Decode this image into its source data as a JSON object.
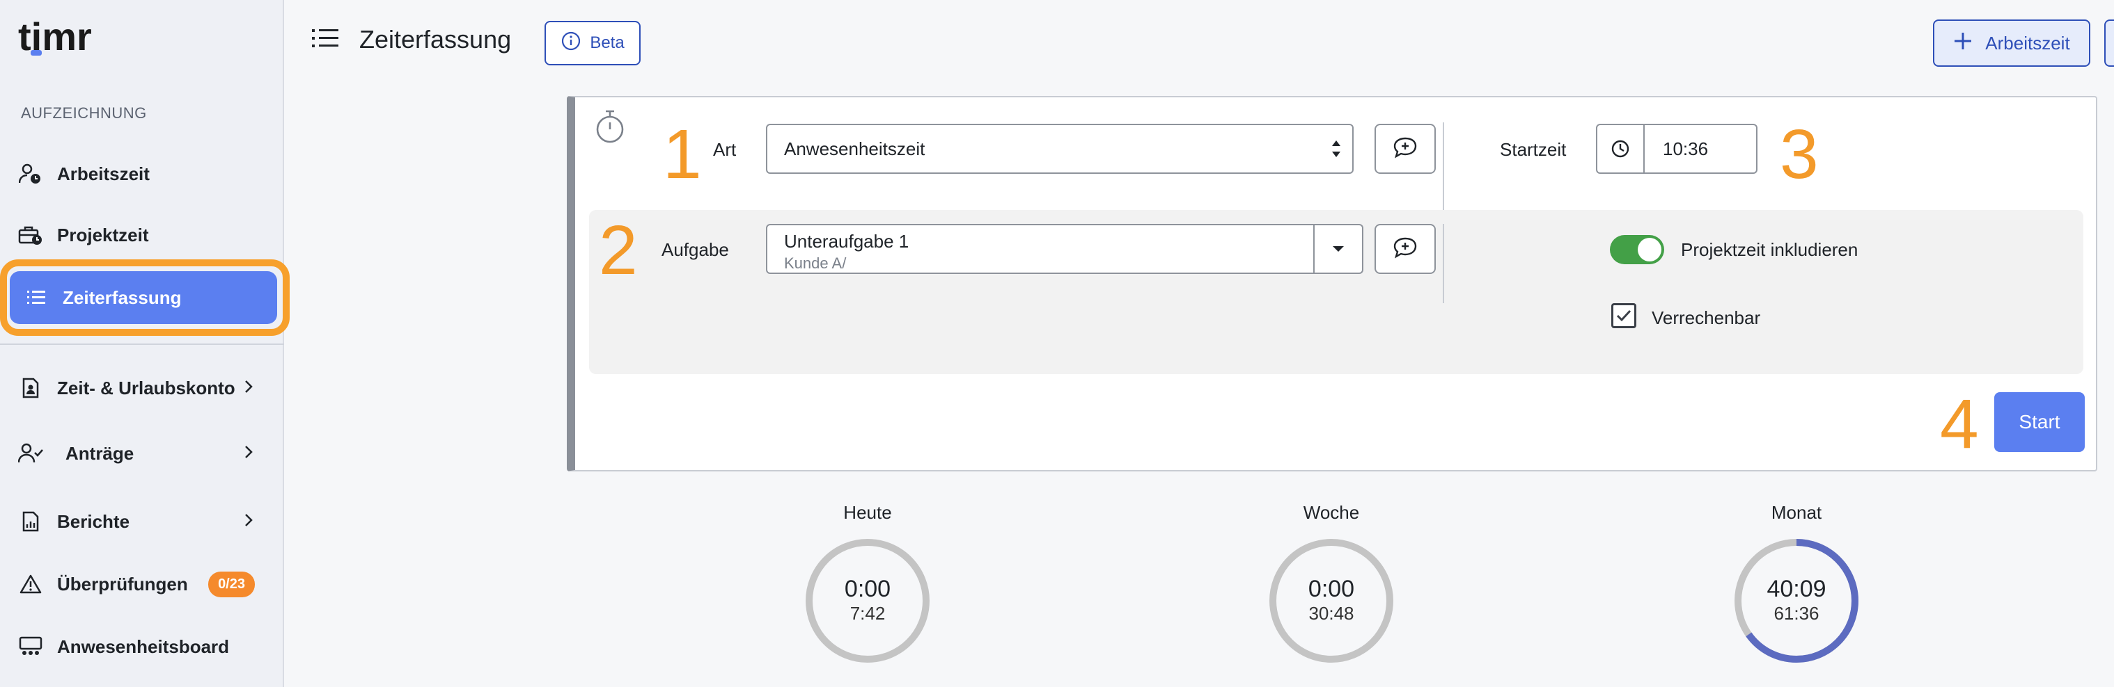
{
  "app": {
    "logo_text": "timr"
  },
  "sidebar": {
    "section_label": "AUFZEICHNUNG",
    "items": [
      {
        "label": "Arbeitszeit",
        "icon": "user-clock-icon"
      },
      {
        "label": "Projektzeit",
        "icon": "briefcase-clock-icon"
      },
      {
        "label": "Zeiterfassung",
        "icon": "list-icon",
        "active": true
      },
      {
        "label": "Zeit- & Urlaubskonto",
        "icon": "file-account-icon"
      },
      {
        "label": "Anträge",
        "icon": "user-check-icon"
      },
      {
        "label": "Berichte",
        "icon": "report-icon"
      },
      {
        "label": "Überprüfungen",
        "icon": "warning-icon",
        "badge": "0/23"
      },
      {
        "label": "Anwesenheitsboard",
        "icon": "board-icon"
      }
    ]
  },
  "header": {
    "title": "Zeiterfassung",
    "beta_label": "Beta",
    "add_button_label": "Arbeitszeit"
  },
  "form": {
    "steps": [
      "1",
      "2",
      "3",
      "4"
    ],
    "art_label": "Art",
    "art_value": "Anwesenheitszeit",
    "aufgabe_label": "Aufgabe",
    "aufgabe_value": "Unteraufgabe 1",
    "aufgabe_sub": "Kunde A/",
    "startzeit_label": "Startzeit",
    "startzeit_value": "10:36",
    "toggle_label": "Projektzeit inkludieren",
    "toggle_on": true,
    "checkbox_label": "Verrechenbar",
    "checkbox_checked": true,
    "start_label": "Start"
  },
  "stats": [
    {
      "label": "Heute",
      "value": "0:00",
      "target": "7:42",
      "progress": 0
    },
    {
      "label": "Woche",
      "value": "0:00",
      "target": "30:48",
      "progress": 0
    },
    {
      "label": "Monat",
      "value": "40:09",
      "target": "61:36",
      "progress": 0.652
    }
  ],
  "colors": {
    "accent": "#5b7ff0",
    "highlight": "#f7a02c",
    "badge": "#f58a2c",
    "toggle": "#43a047",
    "ring_track": "#c4c4c4",
    "ring_progress": "#5c6bc0"
  }
}
